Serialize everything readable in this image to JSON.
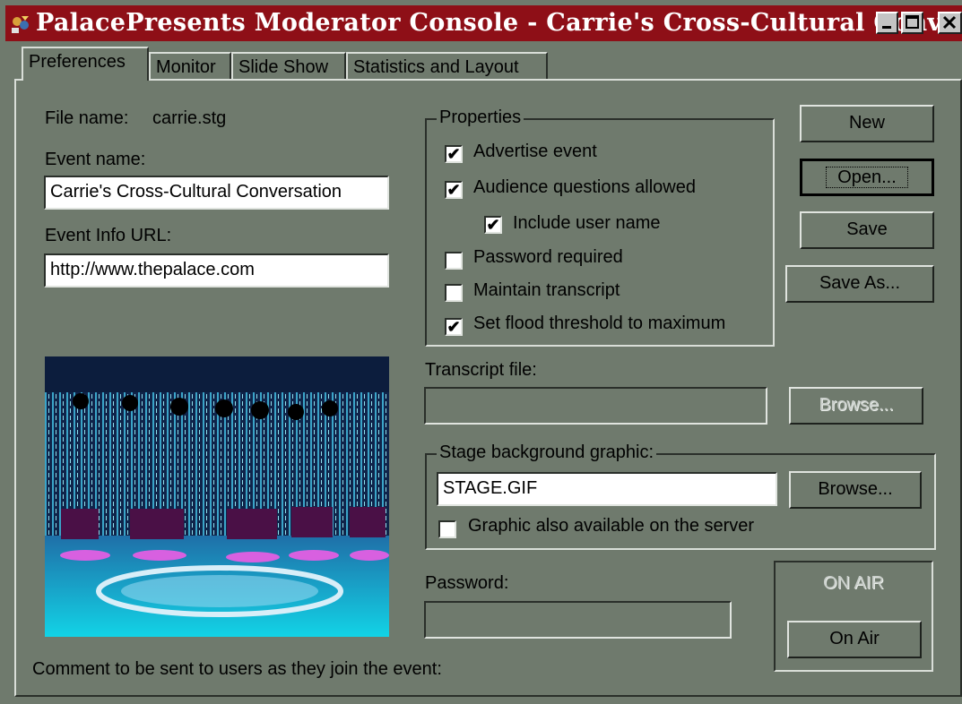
{
  "window": {
    "title": "PalacePresents Moderator Console - Carrie's Cross-Cultural Conver..."
  },
  "title_buttons": {
    "minimize": "minimize",
    "maximize": "maximize",
    "close": "close"
  },
  "tabs": [
    {
      "label": "Preferences",
      "active": true
    },
    {
      "label": "Monitor",
      "active": false
    },
    {
      "label": "Slide Show",
      "active": false
    },
    {
      "label": "Statistics and Layout",
      "active": false
    }
  ],
  "file": {
    "label": "File name:",
    "value": "carrie.stg"
  },
  "event_name": {
    "label": "Event name:",
    "value": "Carrie's Cross-Cultural Conversation"
  },
  "event_info_url": {
    "label": "Event Info URL:",
    "value": "http://www.thepalace.com"
  },
  "properties": {
    "title": "Properties",
    "items": [
      {
        "label": "Advertise event",
        "checked": true
      },
      {
        "label": "Audience questions allowed",
        "checked": true
      },
      {
        "label": "Include user name",
        "checked": true
      },
      {
        "label": "Password required",
        "checked": false
      },
      {
        "label": "Maintain transcript",
        "checked": false
      },
      {
        "label": "Set flood threshold to maximum",
        "checked": true
      }
    ]
  },
  "buttons": {
    "new": "New",
    "open": "Open...",
    "save": "Save",
    "save_as": "Save As..."
  },
  "transcript": {
    "label": "Transcript file:",
    "value": "",
    "browse": "Browse..."
  },
  "stage_background": {
    "title": "Stage background graphic:",
    "value": "STAGE.GIF",
    "browse": "Browse...",
    "server_checkbox_label": "Graphic also available on the server",
    "server_checked": false
  },
  "password": {
    "label": "Password:",
    "value": ""
  },
  "on_air": {
    "status": "ON AIR",
    "button": "On Air"
  },
  "comment": {
    "label": "Comment to be sent to users as they join the event:"
  },
  "colors": {
    "window_bg": "#6f7a6d",
    "titlebar": "#8e0f17"
  }
}
